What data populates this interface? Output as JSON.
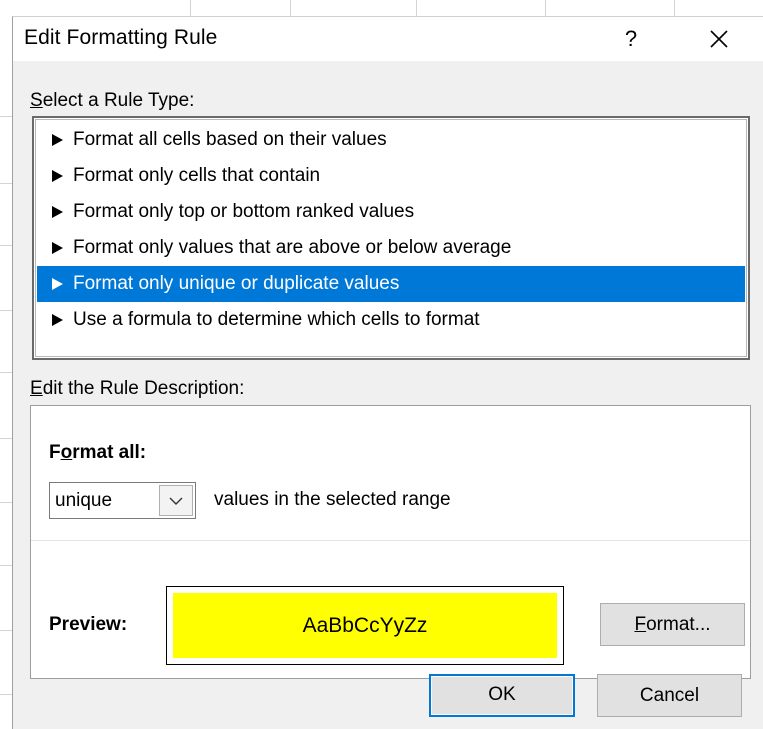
{
  "dialog": {
    "title": "Edit Formatting Rule",
    "help_label": "?"
  },
  "rule_type": {
    "label_accesskey": "S",
    "label_rest": "elect a Rule Type:",
    "items": [
      {
        "label": "Format all cells based on their values",
        "selected": false
      },
      {
        "label": "Format only cells that contain",
        "selected": false
      },
      {
        "label": "Format only top or bottom ranked values",
        "selected": false
      },
      {
        "label": "Format only values that are above or below average",
        "selected": false
      },
      {
        "label": "Format only unique or duplicate values",
        "selected": true
      },
      {
        "label": "Use a formula to determine which cells to format",
        "selected": false
      }
    ]
  },
  "rule_description": {
    "label_accesskey": "E",
    "label_rest": "dit the Rule Description:",
    "format_all_pre": "F",
    "format_all_accesskey": "o",
    "format_all_post": "rmat all:",
    "select_value": "unique",
    "suffix_text": "values in the selected range",
    "preview_label": "Preview:",
    "preview_sample": "AaBbCcYyZz",
    "preview_fill_color": "#ffff00",
    "format_button_accesskey": "F",
    "format_button_rest": "ormat..."
  },
  "buttons": {
    "ok": "OK",
    "cancel": "Cancel"
  },
  "colors": {
    "selection": "#0078d7",
    "dialog_bg": "#f0f0f0"
  },
  "icons": {
    "close": "close-icon",
    "dropdown": "chevron-down-icon",
    "list_bullet": "triangle-right-icon"
  }
}
